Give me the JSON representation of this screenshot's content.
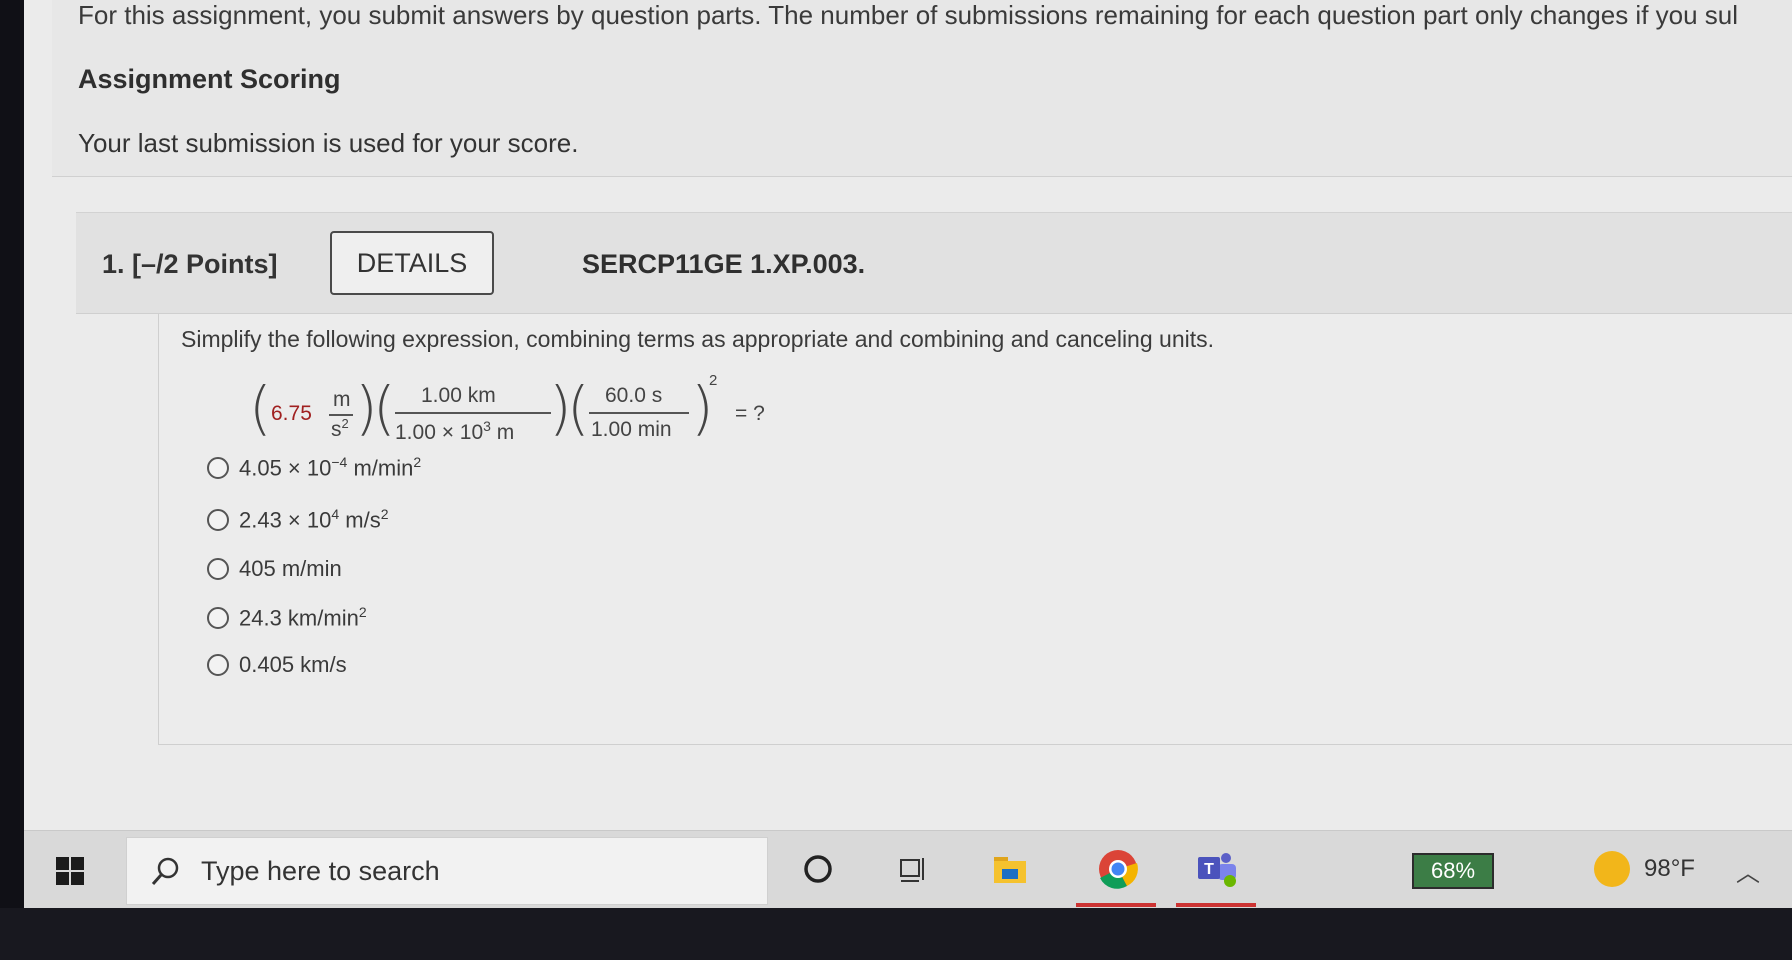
{
  "intro": {
    "text": "For this assignment, you submit answers by question parts. The number of submissions remaining for each question part only changes if you sul",
    "scoring_heading": "Assignment Scoring",
    "scoring_text": "Your last submission is used for your score."
  },
  "question": {
    "number": "1.  [–/2 Points]",
    "details_label": "DETAILS",
    "code": "SERCP11GE 1.XP.003.",
    "prompt": "Simplify the following expression, combining terms as appropriate and combining and canceling units.",
    "expression": {
      "coef": "6.75",
      "unit_num": "m",
      "unit_den": "s2",
      "f2_num": "1.00 km",
      "f2_den": "1.00 × 10",
      "f2_den_exp": "3",
      "f2_den_unit": " m",
      "f3_num": "60.0 s",
      "f3_den": "1.00 min",
      "power": "2",
      "equals": "= ?"
    },
    "options": [
      {
        "base": "4.05 × 10",
        "exp": "−4",
        "unit": " m/min",
        "unit_exp": "2"
      },
      {
        "base": "2.43 × 10",
        "exp": "4",
        "unit": " m/s",
        "unit_exp": "2"
      },
      {
        "base": "405 m/min",
        "exp": "",
        "unit": "",
        "unit_exp": ""
      },
      {
        "base": "24.3 km/min",
        "exp": "",
        "unit": "",
        "unit_exp": "2"
      },
      {
        "base": "0.405 km/s",
        "exp": "",
        "unit": "",
        "unit_exp": ""
      }
    ]
  },
  "taskbar": {
    "search_placeholder": "Type here to search",
    "battery": "68%",
    "temperature": "98°F",
    "icons": [
      "windows-start-icon",
      "search-icon",
      "cortana-icon",
      "task-view-icon",
      "file-explorer-icon",
      "chrome-icon",
      "teams-icon",
      "battery-icon",
      "weather-icon",
      "chevron-up-icon"
    ]
  }
}
